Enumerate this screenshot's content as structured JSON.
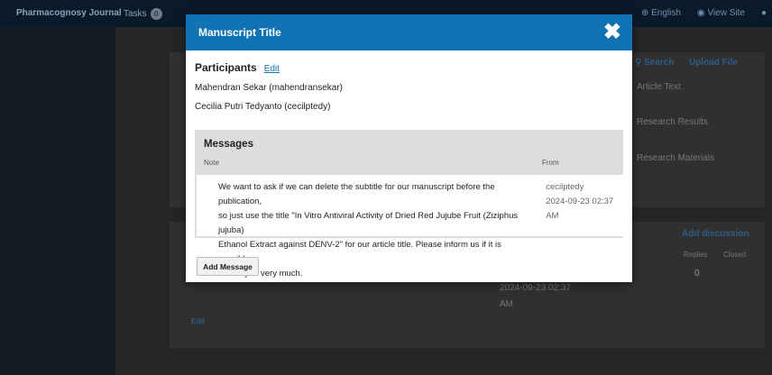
{
  "topbar": {
    "brand": "Pharmacognosy Journal",
    "tasks_label": "Tasks",
    "tasks_count": "0",
    "language": "English",
    "view_site": "View Site"
  },
  "background": {
    "search_label": "Search",
    "upload_file_label": "Upload File",
    "article_text": "Article Text",
    "research_results": "Research Results",
    "research_materials": "Research Materials",
    "add_discussion": "Add discussion",
    "replies_header": "Replies",
    "closed_header": "Closed",
    "reply_count": "0",
    "row_date": "2024-09-23 02:37",
    "row_time_suffix": "AM",
    "edit_label": "Edit"
  },
  "modal": {
    "title": "Manuscript Title",
    "close_glyph": "✖",
    "participants_label": "Participants",
    "edit_label": "Edit",
    "participants": [
      "Mahendran Sekar (mahendransekar)",
      "Cecilia Putri Tedyanto (cecilptedy)"
    ],
    "messages_title": "Messages",
    "columns": {
      "note": "Note",
      "from": "From"
    },
    "message": {
      "note_lines": [
        "We want to ask if we can delete the subtitle for our manuscript before the publication,",
        "so just use the title \"In Vitro Antiviral Activity of Dried Red Jujube Fruit (Ziziphus jujuba)",
        "Ethanol Extract against DENV-2\" for our article title. Please inform us if it is possible.",
        "Thank you very much."
      ],
      "from_user": "cecilptedy",
      "from_date": "2024-09-23 02:37",
      "from_time_suffix": "AM"
    },
    "add_message_label": "Add Message"
  },
  "colors": {
    "modal_header": "#1273b4",
    "link": "#1273b4"
  }
}
